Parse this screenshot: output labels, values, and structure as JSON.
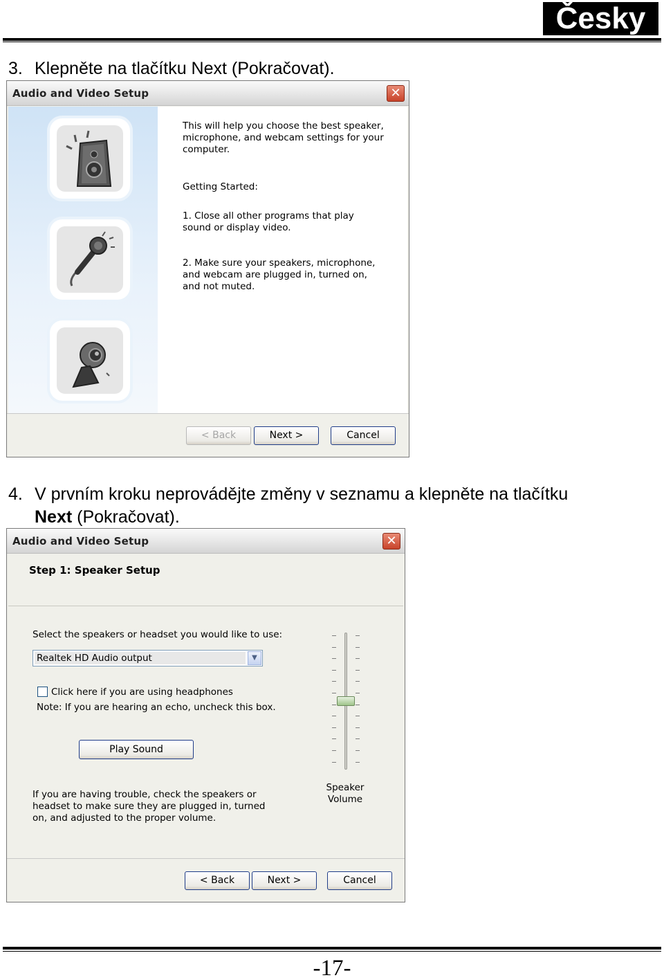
{
  "header": {
    "language": "Česky"
  },
  "steps": [
    {
      "number": "3.",
      "text": "Klepněte na tlačítku Next (Pokračovat)."
    },
    {
      "number": "4.",
      "text_line1": "V prvním kroku neprovádějte změny v seznamu a klepněte na tlačítku",
      "bold": "Next",
      "text_line2": " (Pokračovat)."
    }
  ],
  "dialog1": {
    "title": "Audio and Video Setup",
    "close": "✕",
    "intro": "This will help you choose the best speaker, microphone, and webcam settings for your computer.",
    "getting_started": "Getting Started:",
    "item1": "1. Close all other programs that play sound or display video.",
    "item2": "2. Make sure your speakers, microphone, and webcam are plugged in, turned on, and not muted.",
    "icons": [
      "speaker-icon",
      "microphone-icon",
      "webcam-icon"
    ],
    "buttons": {
      "back": "< Back",
      "next": "Next >",
      "cancel": "Cancel"
    }
  },
  "dialog2": {
    "title": "Audio and Video Setup",
    "close": "✕",
    "step_title": "Step 1: Speaker Setup",
    "select_label": "Select the speakers or headset you would like to use:",
    "select_value": "Realtek HD Audio output",
    "headphones_checkbox": "Click here if you are using headphones",
    "echo_note": "Note: If you are hearing an echo, uncheck this box.",
    "play_sound": "Play Sound",
    "trouble_text": "If you are having trouble, check the speakers or headset to make sure they are plugged in, turned on, and adjusted to the proper volume.",
    "volume_label": "Speaker Volume",
    "volume_level": 0.5,
    "buttons": {
      "back": "< Back",
      "next": "Next >",
      "cancel": "Cancel"
    }
  },
  "footer": {
    "page_number": "-17-"
  }
}
